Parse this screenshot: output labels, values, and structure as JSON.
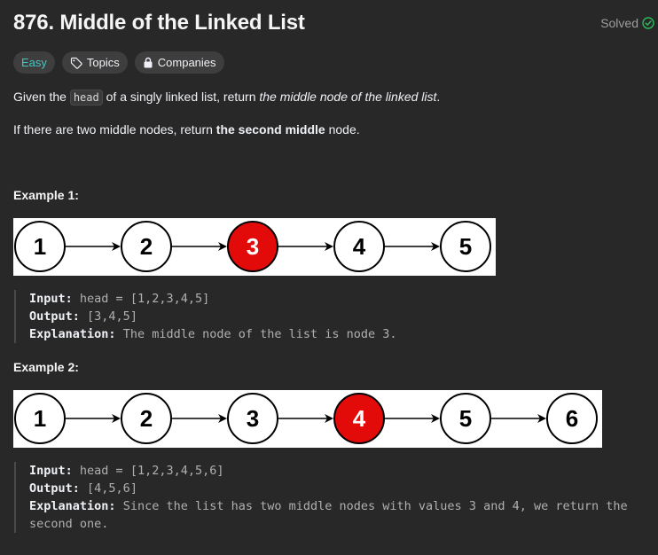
{
  "problem": {
    "title": "876. Middle of the Linked List",
    "status": "Solved",
    "difficulty": "Easy",
    "topics_label": "Topics",
    "companies_label": "Companies"
  },
  "description": {
    "p1_before": "Given the ",
    "p1_code": "head",
    "p1_mid": " of a singly linked list, return ",
    "p1_em": "the middle node of the linked list",
    "p1_end": ".",
    "p2_before": "If there are two middle nodes, return ",
    "p2_bold": "the second middle",
    "p2_end": " node."
  },
  "examples": [
    {
      "heading": "Example 1:",
      "nodes": [
        "1",
        "2",
        "3",
        "4",
        "5"
      ],
      "highlight_index": 2,
      "input_label": "Input:",
      "input": "head = [1,2,3,4,5]",
      "output_label": "Output:",
      "output": "[3,4,5]",
      "explanation_label": "Explanation:",
      "explanation": "The middle node of the list is node 3."
    },
    {
      "heading": "Example 2:",
      "nodes": [
        "1",
        "2",
        "3",
        "4",
        "5",
        "6"
      ],
      "highlight_index": 3,
      "input_label": "Input:",
      "input": "head = [1,2,3,4,5,6]",
      "output_label": "Output:",
      "output": "[4,5,6]",
      "explanation_label": "Explanation:",
      "explanation": "Since the list has two middle nodes with values 3 and 4, we return the",
      "explanation_cont": "second one."
    }
  ],
  "colors": {
    "easy": "#46c6c2",
    "highlight_node": "#e30a0a",
    "solved_check": "#2cbb5d"
  },
  "icons": {
    "solved": "check-circle-icon",
    "topics": "tag-icon",
    "companies": "lock-icon"
  }
}
